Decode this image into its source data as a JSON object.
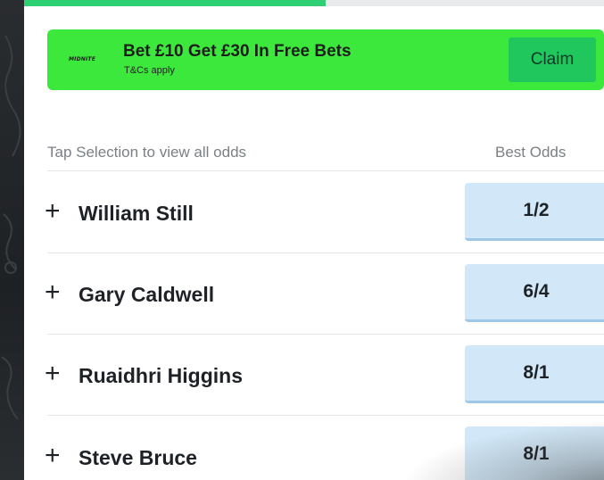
{
  "progress": {
    "fraction": 0.52
  },
  "promo": {
    "logo_text": "MIDNITE",
    "headline": "Bet £10 Get £30 In Free Bets",
    "terms": "T&Cs apply",
    "claim_label": "Claim",
    "background_color": "#3de83d"
  },
  "table": {
    "hint": "Tap Selection to view all odds",
    "odds_header": "Best Odds",
    "rows": [
      {
        "icon": "plus-icon",
        "name": "William Still",
        "odds": "1/2"
      },
      {
        "icon": "plus-icon",
        "name": "Gary Caldwell",
        "odds": "6/4"
      },
      {
        "icon": "plus-icon",
        "name": "Ruaidhri Higgins",
        "odds": "8/1"
      },
      {
        "icon": "plus-icon",
        "name": "Steve Bruce",
        "odds": "8/1"
      }
    ]
  },
  "colors": {
    "accent_green": "#2fcf73",
    "odds_background": "#d2e8f8"
  }
}
